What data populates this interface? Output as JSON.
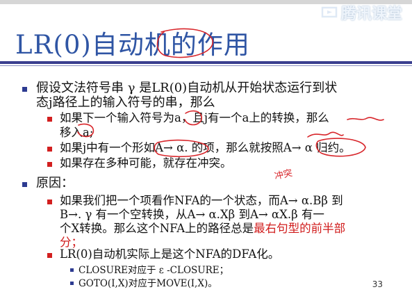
{
  "watermark": {
    "text": "腾讯课堂"
  },
  "slide": {
    "title": "LR(0)自动机的作用",
    "page_number": "33",
    "lines": [
      "假设文法符号串 γ 是LR(0)自动机从开始状态运行到状",
      "态j路径上的输入符号的串，那么",
      "如果下一个输入符号为a，且j有一个a上的转换，那么",
      "移入a;",
      "如果j中有一个形如A→ α. 的项，那么就按照A→ α 归约。",
      "如果存在多种可能，就存在冲突。",
      "原因：",
      "如果我们把一个项看作NFA的一个状态，而A→ α.Bβ 到",
      "B→. γ 有一个空转换，从A→ α.Xβ 到A→ αX.β 有一",
      "个X转换。那么这个NFA上的路径总是",
      "最右句型的前半部",
      "分；",
      "LR(0)自动机实际上是这个NFA的DFA化。",
      "CLOSURE对应于 ε -CLOSURE；",
      "GOTO(I,X)对应于MOVE(I,X)。"
    ]
  },
  "annotation": {
    "handwriting": "冲突"
  },
  "colors": {
    "title": "#2f55a4",
    "highlight": "#d01a1a",
    "ink": "#d8262b",
    "rule": "#3a3f8f"
  }
}
